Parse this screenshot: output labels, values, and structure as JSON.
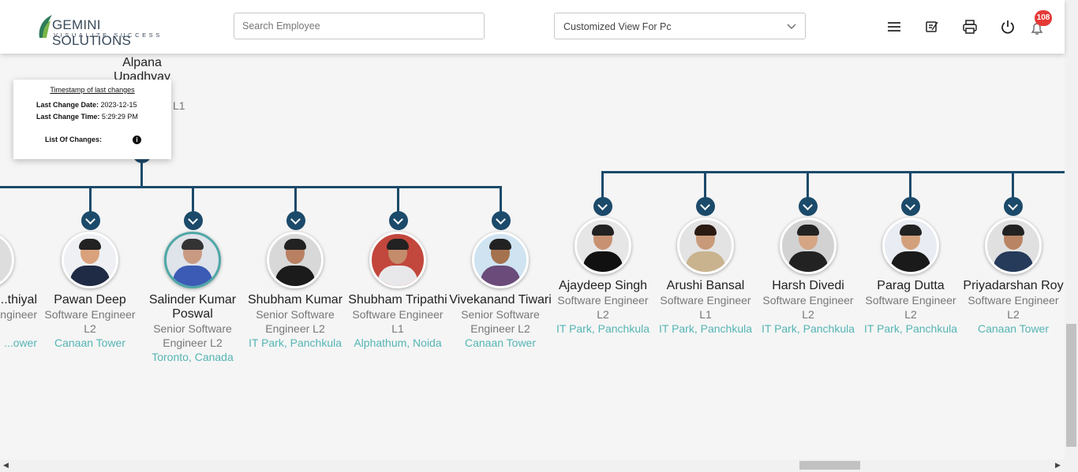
{
  "header": {
    "logo_main": "GEMINI SOLUTIONS",
    "logo_sub": "VISUALIZE SUCCESS",
    "search_placeholder": "Search Employee",
    "view_select_value": "Customized View For Pc",
    "notification_count": "108",
    "icons": [
      "menu-icon",
      "edit-note-icon",
      "print-icon",
      "power-icon",
      "bell-icon"
    ]
  },
  "manager": {
    "name": "Alpana Upadhyay",
    "role_fragment": "L1"
  },
  "tooltip": {
    "title": "Timestamp of last changes",
    "date_label": "Last Change Date:",
    "date_value": "2023-12-15",
    "time_label": "Last Change Time:",
    "time_value": "5:29:29 PM",
    "changes_label": "List Of Changes:"
  },
  "employees_left": [
    {
      "name": "...thiyal",
      "role": "...ngineer",
      "loc": "...ower"
    },
    {
      "name": "Pawan Deep",
      "role": "Software Engineer L2",
      "loc": "Canaan Tower"
    },
    {
      "name": "Salinder Kumar Poswal",
      "role": "Senior Software Engineer L2",
      "loc": "Toronto, Canada"
    },
    {
      "name": "Shubham Kumar",
      "role": "Senior Software Engineer L2",
      "loc": "IT Park, Panchkula"
    },
    {
      "name": "Shubham Tripathi",
      "role": "Software Engineer L1",
      "loc": "Alphathum, Noida"
    },
    {
      "name": "Vivekanand Tiwari",
      "role": "Senior Software Engineer L2",
      "loc": "Canaan Tower"
    }
  ],
  "employees_right": [
    {
      "name": "Ajaydeep Singh",
      "role": "Software Engineer L2",
      "loc": "IT Park, Panchkula"
    },
    {
      "name": "Arushi Bansal",
      "role": "Software Engineer L1",
      "loc": "IT Park, Panchkula"
    },
    {
      "name": "Harsh Divedi",
      "role": "Software Engineer L2",
      "loc": "IT Park, Panchkula"
    },
    {
      "name": "Parag Dutta",
      "role": "Software Engineer L2",
      "loc": "IT Park, Panchkula"
    },
    {
      "name": "Priyadarshan Roy",
      "role": "Software Engineer L2",
      "loc": "Canaan Tower"
    }
  ],
  "colors": {
    "connector": "#1c4a6a",
    "location": "#56b4b4",
    "badge": "#e53935"
  }
}
